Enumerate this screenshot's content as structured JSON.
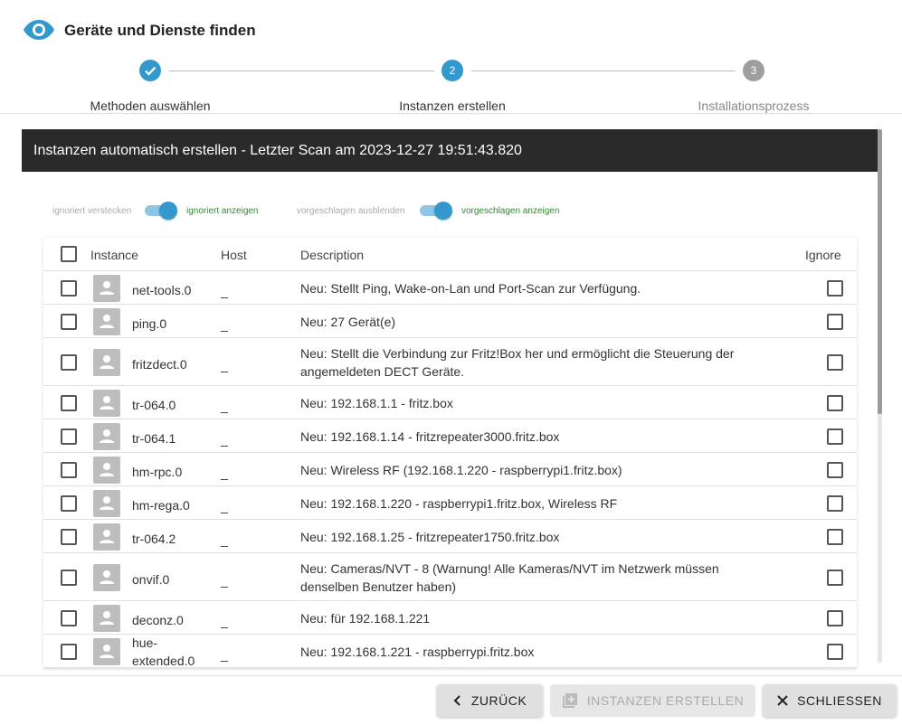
{
  "dialog": {
    "title": "Geräte und Dienste finden",
    "icon": "eye-icon",
    "accent_color": "#3399cc"
  },
  "stepper": {
    "steps": [
      {
        "number": "1",
        "label": "Methoden auswählen",
        "state": "completed"
      },
      {
        "number": "2",
        "label": "Instanzen erstellen",
        "state": "active"
      },
      {
        "number": "3",
        "label": "Installationsprozess",
        "state": "pending"
      }
    ]
  },
  "banner": {
    "text": "Instanzen automatisch erstellen - Letzter Scan am 2023-12-27 19:51:43.820"
  },
  "toggles": {
    "ignored": {
      "off_label": "ignoriert verstecken",
      "on_label": "ignoriert anzeigen",
      "checked": true
    },
    "suggested": {
      "off_label": "vorgeschlagen ausblenden",
      "on_label": "vorgeschlagen anzeigen",
      "checked": true
    }
  },
  "table": {
    "headers": {
      "instance": "Instance",
      "host": "Host",
      "description": "Description",
      "ignore": "Ignore"
    },
    "rows": [
      {
        "instance": "net-tools.0",
        "host": "_",
        "description": "Neu: Stellt Ping, Wake-on-Lan und Port-Scan zur Verfügung."
      },
      {
        "instance": "ping.0",
        "host": "_",
        "description": "Neu: 27 Gerät(e)"
      },
      {
        "instance": "fritzdect.0",
        "host": "_",
        "description": "Neu: Stellt die Verbindung zur Fritz!Box her und ermöglicht die Steuerung der angemeldeten DECT Geräte."
      },
      {
        "instance": "tr-064.0",
        "host": "_",
        "description": "Neu: 192.168.1.1 - fritz.box"
      },
      {
        "instance": "tr-064.1",
        "host": "_",
        "description": "Neu: 192.168.1.14 - fritzrepeater3000.fritz.box"
      },
      {
        "instance": "hm-rpc.0",
        "host": "_",
        "description": "Neu: Wireless RF (192.168.1.220 - raspberrypi1.fritz.box)"
      },
      {
        "instance": "hm-rega.0",
        "host": "_",
        "description": "Neu: 192.168.1.220 - raspberrypi1.fritz.box, Wireless RF"
      },
      {
        "instance": "tr-064.2",
        "host": "_",
        "description": "Neu: 192.168.1.25 - fritzrepeater1750.fritz.box"
      },
      {
        "instance": "onvif.0",
        "host": "_",
        "description": "Neu: Cameras/NVT - 8 (Warnung! Alle Kameras/NVT im Netzwerk müssen denselben Benutzer haben)"
      },
      {
        "instance": "deconz.0",
        "host": "_",
        "description": "Neu: für 192.168.1.221"
      },
      {
        "instance": "hue-extended.0",
        "host": "_",
        "description": "Neu: 192.168.1.221 - raspberrypi.fritz.box"
      }
    ]
  },
  "footer": {
    "back_label": "ZURÜCK",
    "create_label": "INSTANZEN ERSTELLEN",
    "close_label": "SCHLIESSEN"
  }
}
